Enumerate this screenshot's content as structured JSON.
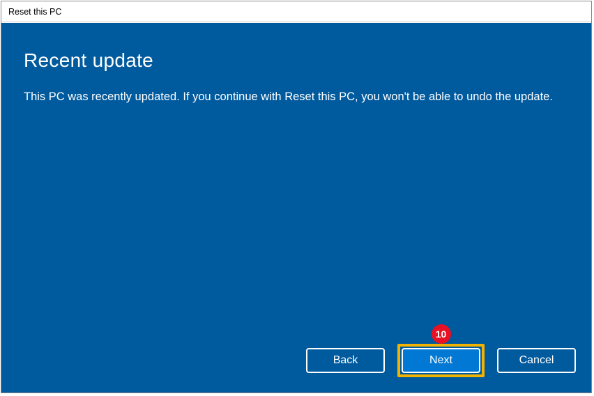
{
  "window": {
    "title": "Reset this PC"
  },
  "page": {
    "heading": "Recent update",
    "body": "This PC was recently updated. If you continue with Reset this PC, you won't be able to undo the update."
  },
  "buttons": {
    "back": "Back",
    "next": "Next",
    "cancel": "Cancel"
  },
  "annotation": {
    "step": "10"
  }
}
